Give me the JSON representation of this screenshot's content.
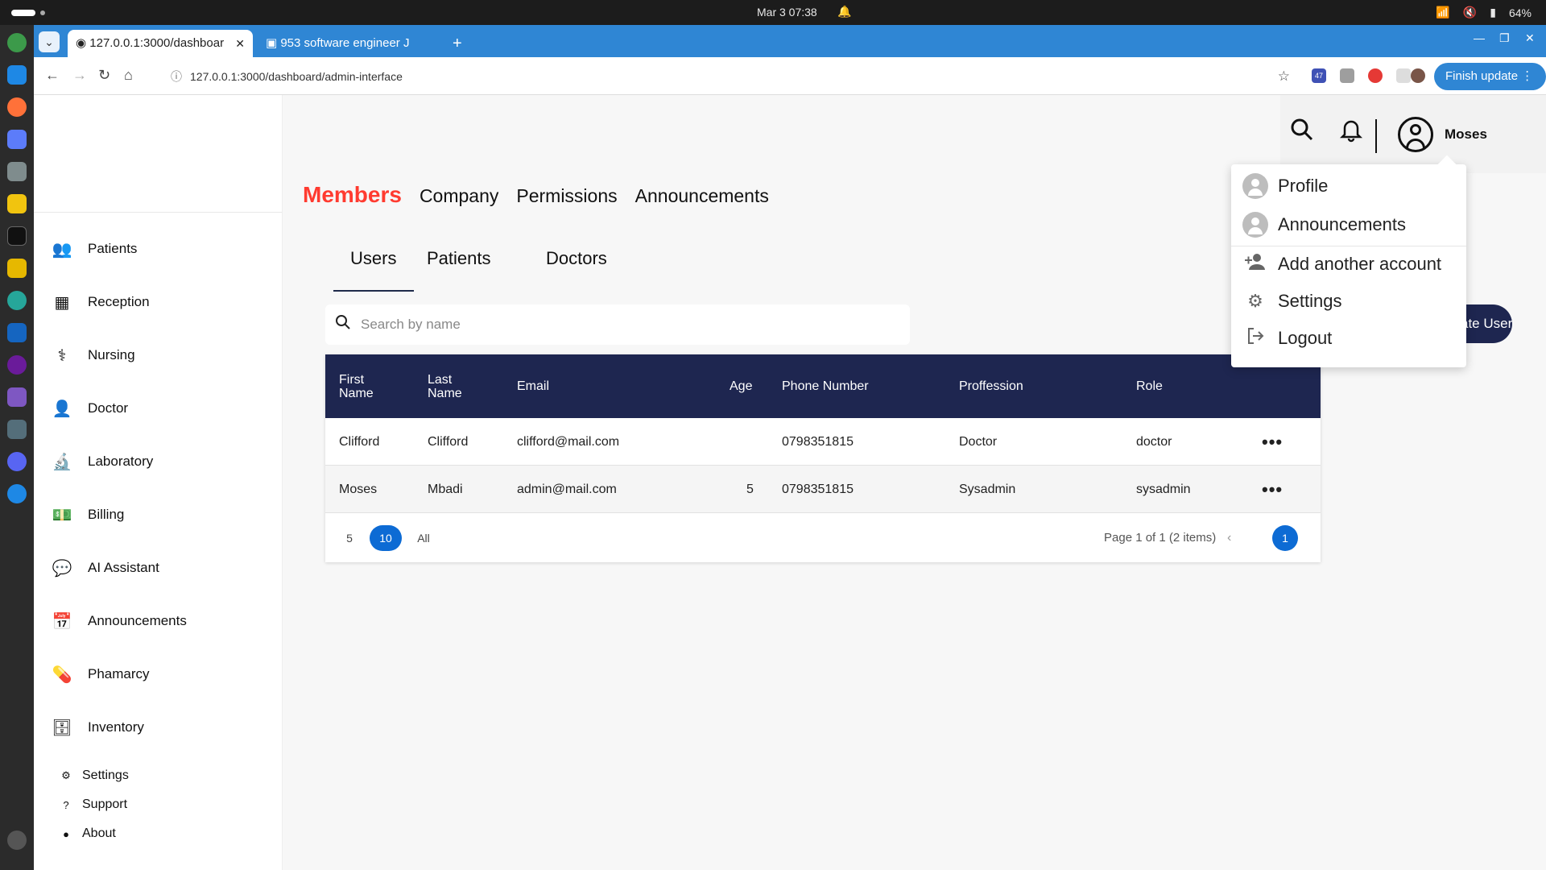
{
  "os": {
    "clock": "Mar 3  07:38",
    "battery": "64%"
  },
  "browser": {
    "tabs": [
      {
        "label": "127.0.0.1:3000/dashboar",
        "active": true
      },
      {
        "label": "953 software engineer J",
        "active": false
      }
    ],
    "url": "127.0.0.1:3000/dashboard/admin-interface",
    "extension_badge": "47",
    "finish_update": "Finish update"
  },
  "sidebar": {
    "items": [
      {
        "label": "Patients",
        "icon": "people-icon"
      },
      {
        "label": "Reception",
        "icon": "dashboard-icon"
      },
      {
        "label": "Nursing",
        "icon": "nurse-icon"
      },
      {
        "label": "Doctor",
        "icon": "doctor-icon"
      },
      {
        "label": "Laboratory",
        "icon": "microscope-icon"
      },
      {
        "label": "Billing",
        "icon": "money-icon"
      },
      {
        "label": "AI Assistant",
        "icon": "chat-icon"
      },
      {
        "label": "Announcements",
        "icon": "calendar-icon"
      },
      {
        "label": "Phamarcy",
        "icon": "pill-icon"
      },
      {
        "label": "Inventory",
        "icon": "archive-icon"
      }
    ],
    "bottom": [
      {
        "label": "Settings",
        "icon": "gear-icon"
      },
      {
        "label": "Support",
        "icon": "help-icon"
      },
      {
        "label": "About",
        "icon": "info-icon"
      }
    ]
  },
  "header": {
    "username": "Moses"
  },
  "main_tabs": [
    "Members",
    "Company",
    "Permissions",
    "Announcements"
  ],
  "sub_tabs": [
    "Users",
    "Patients",
    "Doctors"
  ],
  "search": {
    "placeholder": "Search by name"
  },
  "create_button": "ate User",
  "table": {
    "headers": [
      "First Name",
      "Last Name",
      "Email",
      "Age",
      "Phone Number",
      "Proffession",
      "Role"
    ],
    "rows": [
      {
        "first": "Clifford",
        "last": "Clifford",
        "email": "clifford@mail.com",
        "age": "",
        "phone": "0798351815",
        "profession": "Doctor",
        "role": "doctor"
      },
      {
        "first": "Moses",
        "last": "Mbadi",
        "email": "admin@mail.com",
        "age": "5",
        "phone": "0798351815",
        "profession": "Sysadmin",
        "role": "sysadmin"
      }
    ],
    "page_sizes": [
      "5",
      "10",
      "All"
    ],
    "page_info": "Page 1 of 1 (2 items)",
    "current_page": "1"
  },
  "dropdown": {
    "items": [
      "Profile",
      "Announcements",
      "Add another account",
      "Settings",
      "Logout"
    ]
  },
  "colors": {
    "accent_red": "#ff3b30",
    "navy": "#1e2650",
    "blue": "#0d6bd4",
    "chrome_blue": "#2f86d4"
  }
}
